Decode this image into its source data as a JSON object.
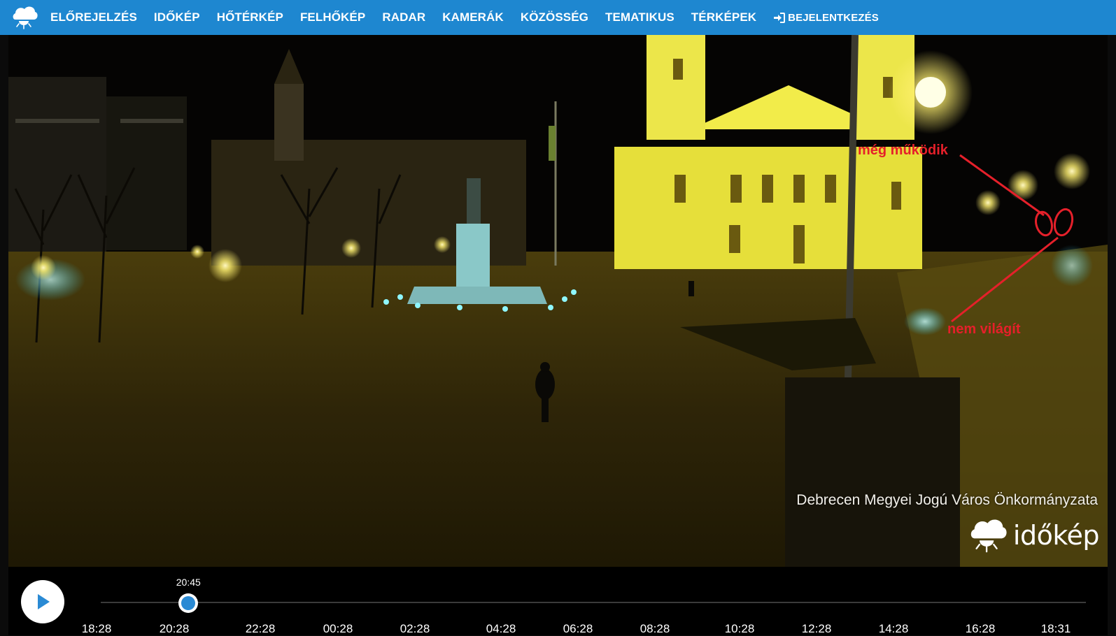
{
  "nav": {
    "items": [
      "ELŐREJELZÉS",
      "IDŐKÉP",
      "HŐTÉRKÉP",
      "FELHŐKÉP",
      "RADAR",
      "KAMERÁK",
      "KÖZÖSSÉG",
      "TEMATIKUS",
      "TÉRKÉPEK"
    ],
    "login_label": "BEJELENTKEZÉS",
    "color": "#1e87d0"
  },
  "camera": {
    "credit": "Debrecen Megyei Jogú Város Önkormányzata",
    "watermark": "időkép",
    "annotations": {
      "working": "még működik",
      "not_lit": "nem világít",
      "color": "#e5202a"
    }
  },
  "timeline": {
    "current_time": "20:45",
    "position": 0.089,
    "ticks": [
      "18:28",
      "20:28",
      "22:28",
      "00:28",
      "02:28",
      "04:28",
      "06:28",
      "08:28",
      "10:28",
      "12:28",
      "14:28",
      "16:28",
      "18:31"
    ],
    "accent": "#2a8ad4"
  }
}
